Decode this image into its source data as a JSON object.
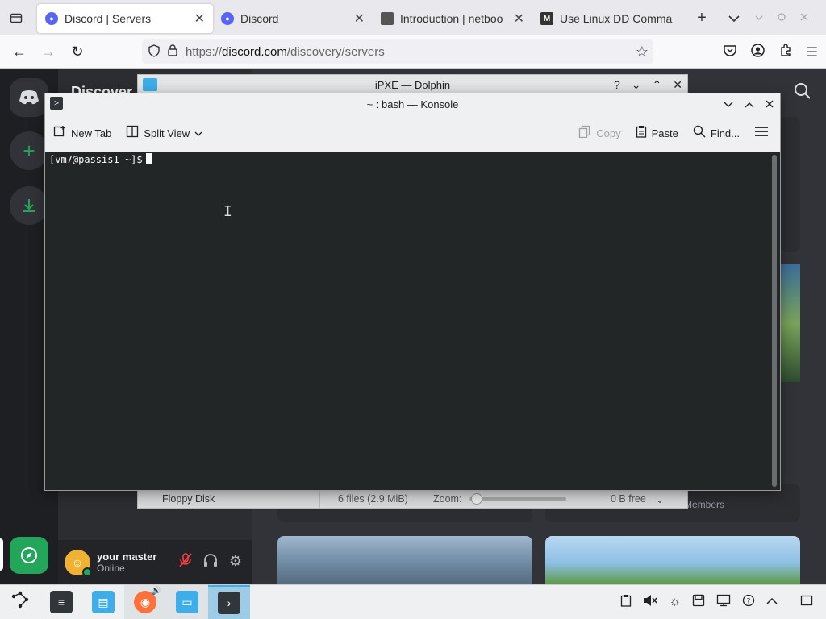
{
  "firefox": {
    "tabs": [
      {
        "title": "Discord | Servers",
        "favicon": "discord-icon",
        "active": true
      },
      {
        "title": "Discord",
        "favicon": "discord-icon",
        "active": false
      },
      {
        "title": "Introduction | netboo",
        "favicon": "netboot-icon",
        "active": false
      },
      {
        "title": "Use Linux DD Comma",
        "favicon": "medium-icon",
        "active": false
      }
    ],
    "url_prefix": "https://",
    "url_domain": "discord.com",
    "url_path": "/discovery/servers"
  },
  "discord": {
    "header_title": "Discover",
    "members_text": "Members",
    "user": {
      "name": "your master",
      "status": "Online"
    },
    "colors": {
      "blurple": "#5865f2",
      "green": "#23a55a",
      "bg": "#313338"
    }
  },
  "dolphin": {
    "title": "iPXE — Dolphin",
    "place": "Floppy Disk",
    "files": "6 files (2.9 MiB)",
    "zoom_label": "Zoom:",
    "free": "0 B free"
  },
  "konsole": {
    "title": "~ : bash — Konsole",
    "toolbar": {
      "new_tab": "New Tab",
      "split_view": "Split View",
      "copy": "Copy",
      "paste": "Paste",
      "find": "Find..."
    },
    "prompt": "[vm7@passis1 ~]$"
  }
}
